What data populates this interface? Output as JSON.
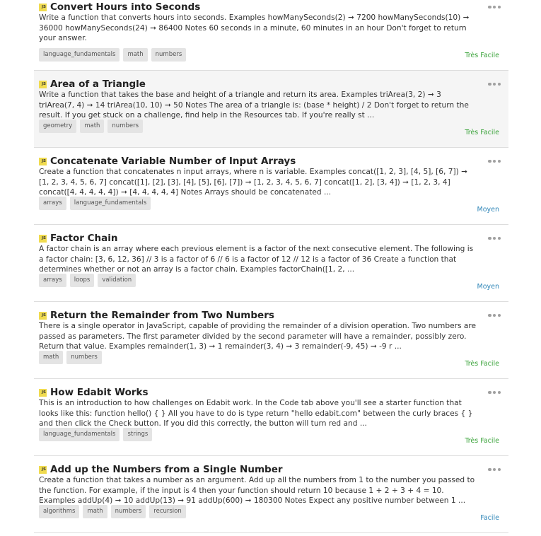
{
  "colors": {
    "very_easy": "#3aa33a",
    "easy": "#2f86b8",
    "medium": "#2f86b8",
    "js_badge": "#f0db4f",
    "tag_bg": "#e4e4e4"
  },
  "icons": {
    "language_badge": "JS",
    "menu": "more-horizontal-icon"
  },
  "challenges": [
    {
      "title": "Convert Hours into Seconds",
      "description": "Write a function that converts hours into seconds. Examples howManySeconds(2) ➞ 7200 howManySeconds(10) ➞ 36000 howManySeconds(24) ➞ 86400 Notes 60 seconds in a minute, 60 minutes in an hour Don't forget to return your answer.",
      "tags": [
        "language_fundamentals",
        "math",
        "numbers"
      ],
      "difficulty": "Très Facile",
      "level": "easy"
    },
    {
      "title": "Area of a Triangle",
      "description": "Write a function that takes the base and height of a triangle and return its area. Examples triArea(3, 2) ➞ 3 triArea(7, 4) ➞ 14 triArea(10, 10) ➞ 50 Notes The area of a triangle is: (base * height) / 2 Don't forget to return the result. If you get stuck on a challenge, find help in the Resources tab. If you're really st ...",
      "tags": [
        "geometry",
        "math",
        "numbers"
      ],
      "difficulty": "Très Facile",
      "level": "easy"
    },
    {
      "title": "Concatenate Variable Number of Input Arrays",
      "description": "Create a function that concatenates n input arrays, where n is variable. Examples concat([1, 2, 3], [4, 5], [6, 7]) ➞ [1, 2, 3, 4, 5, 6, 7] concat([1], [2], [3], [4], [5], [6], [7]) ➞ [1, 2, 3, 4, 5, 6, 7] concat([1, 2], [3, 4]) ➞ [1, 2, 3, 4] concat([4, 4, 4, 4, 4]) ➞ [4, 4, 4, 4, 4] Notes Arrays should be concatenated ...",
      "tags": [
        "arrays",
        "language_fundamentals"
      ],
      "difficulty": "Moyen",
      "level": "medium"
    },
    {
      "title": "Factor Chain",
      "description": "A factor chain is an array where each previous element is a factor of the next consecutive element. The following is a factor chain: [3, 6, 12, 36] // 3 is a factor of 6 // 6 is a factor of 12 // 12 is a factor of 36 Create a function that determines whether or not an array is a factor chain. Examples factorChain([1, 2, ...",
      "tags": [
        "arrays",
        "loops",
        "validation"
      ],
      "difficulty": "Moyen",
      "level": "medium"
    },
    {
      "title": "Return the Remainder from Two Numbers",
      "description": "There is a single operator in JavaScript, capable of providing the remainder of a division operation. Two numbers are passed as parameters. The first parameter divided by the second parameter will have a remainder, possibly zero. Return that value. Examples remainder(1, 3) ➞ 1 remainder(3, 4) ➞ 3 remainder(-9, 45) ➞ -9 r ...",
      "tags": [
        "math",
        "numbers"
      ],
      "difficulty": "Très Facile",
      "level": "easy"
    },
    {
      "title": "How Edabit Works",
      "description": "This is an introduction to how challenges on Edabit work. In the Code tab above you'll see a starter function that looks like this: function hello() { } All you have to do is type return \"hello edabit.com\" between the curly braces { } and then click the Check button. If you did this correctly, the button will turn red and ...",
      "tags": [
        "language_fundamentals",
        "strings"
      ],
      "difficulty": "Très Facile",
      "level": "easy"
    },
    {
      "title": "Add up the Numbers from a Single Number",
      "description": "Create a function that takes a number as an argument. Add up all the numbers from 1 to the number you passed to the function. For example, if the input is 4 then your function should return 10 because 1 + 2 + 3 + 4 = 10. Examples addUp(4) ➞ 10 addUp(13) ➞ 91 addUp(600) ➞ 180300 Notes Expect any positive number between 1 ...",
      "tags": [
        "algorithms",
        "math",
        "numbers",
        "recursion"
      ],
      "difficulty": "Facile",
      "level": "medium"
    }
  ]
}
